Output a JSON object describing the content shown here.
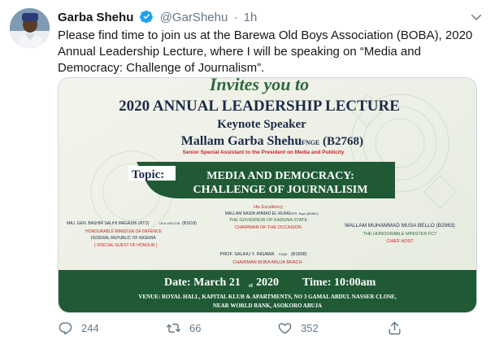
{
  "tweet": {
    "author_name": "Garba Shehu",
    "handle": "@GarShehu",
    "separator": "·",
    "time": "1h",
    "text": "Please find time to join us at the Barewa Old Boys Association (BOBA), 2020 Annual Leadership Lecture, where I will be speaking on “Media and Democracy: Challenge of Journalism”."
  },
  "flyer": {
    "invites": "Invites you to",
    "title": "2020 ANNUAL LEADERSHIP LECTURE",
    "keynote_label": "Keynote Speaker",
    "speaker_name": "Mallam Garba Shehu",
    "speaker_suffix": "FNGE",
    "speaker_code": "(B2768)",
    "speaker_role": "Senior Special Assistant to the President on Media and Publicity",
    "topic_label": "Topic:",
    "topic_line1": "MEDIA AND DEMOCRACY:",
    "topic_line2": "CHALLENGE OF JOURNALISIM",
    "chair_honorific": "His Excellency",
    "chair_name": "MALLAM NASIR AHMAD EL-RUFAI",
    "chair_name_suffix": "OFR, fmps (B2661)",
    "chair_title": "THE GOVERNOR OF KADUNA STATE",
    "chair_role": "CHAIRMAN OF THE OCCASION",
    "guest_name": "MAJ. GEN. BASHIR SALIHI MAGASHI (RTD)",
    "guest_name_suffix": "LB M JOM CON",
    "guest_code": "(B1618)",
    "guest_title": "HONOURABLE MINISTER OF DEFENCE",
    "guest_country": "FEDERAL REPUBLIC OF NIGERIA",
    "guest_role": "{ SPECIAL GUEST OF HONOUR }",
    "host_name": "MALLAM MUHAMMAD MUSA BELLO (B2963)",
    "host_title": "THE HONOURABLE MINISTER FCT",
    "host_role": "CHIEF HOST",
    "prof_name": "PROF. SALIHU Y. INGAWA",
    "prof_name_suffix": "FNAE",
    "prof_code": "(B1898)",
    "prof_role": "CHAIRMAN BOBA ABUJA BRACH",
    "date_label": "Date: March 21",
    "date_suffix": "st",
    "date_year": "2020",
    "time_label": "Time: 10:00am",
    "venue_line1": "VENUE: ROYAL HALL, KAPITAL KLUB & APARTMENTS, NO 3 GAMAL ABDUL NASSER CLOSE,",
    "venue_line2": "NEAR WORLD BANK, ASOKORO ABUJA"
  },
  "actions": {
    "replies": "244",
    "retweets": "66",
    "likes": "352"
  },
  "colors": {
    "brand_blue": "#1da1f2",
    "flyer_green": "#1f5a35",
    "flyer_navy": "#1c2a4a",
    "flyer_red": "#c8242b",
    "flyer_bg": "#edf0e6"
  }
}
